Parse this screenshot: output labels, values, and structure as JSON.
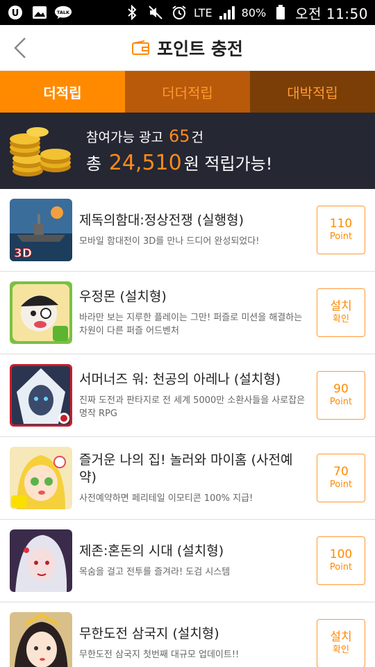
{
  "status_bar": {
    "talk_label": "TALK",
    "network": "LTE",
    "battery": "80%",
    "time": "오전 11:50"
  },
  "header": {
    "title": "포인트 충전",
    "back_icon": "chevron-left-icon",
    "title_icon": "wallet-icon"
  },
  "tabs": [
    {
      "label": "더적립",
      "active": true
    },
    {
      "label": "더더적립",
      "active": false
    },
    {
      "label": "대박적립",
      "active": false
    }
  ],
  "banner": {
    "line1_prefix": "참여가능 광고",
    "ad_count": "65",
    "line1_suffix": "건",
    "line2_prefix": "총",
    "total_points": "24,510",
    "line2_suffix": "원 적립가능!"
  },
  "items": [
    {
      "title": "제독의함대:정상전쟁 (실행형)",
      "desc": "모바일 함대전이 3D를 만나 드디어 완성되었다!",
      "point_top": "110",
      "point_bottom": "Point",
      "thumb_label": "3D"
    },
    {
      "title": "우정몬 (설치형)",
      "desc": "바라만 보는 지루한 플레이는 그만! 퍼즐로 미션을 해결하는 차원이 다른 퍼즐 어드벤처",
      "point_top": "설치",
      "point_bottom": "확인"
    },
    {
      "title": "서머너즈 워: 천공의 아레나 (설치형)",
      "desc": "진짜 도전과 판타지로 전 세계 5000만 소환사들을 사로잡은 명작 RPG",
      "point_top": "90",
      "point_bottom": "Point"
    },
    {
      "title": "즐거운 나의 집! 놀러와 마이홈 (사전예약)",
      "desc": "사전예약하면 페리테일 이모티콘 100% 지급!",
      "point_top": "70",
      "point_bottom": "Point"
    },
    {
      "title": "제존:혼돈의 시대 (설치형)",
      "desc": "목숨을 걸고 전투를 즐겨라! 도검 시스템",
      "point_top": "100",
      "point_bottom": "Point"
    },
    {
      "title": "무한도전 삼국지 (설치형)",
      "desc": "무한도전 삼국지 첫번째 대규모 업데이트!!",
      "point_top": "설치",
      "point_bottom": "확인"
    }
  ],
  "colors": {
    "accent": "#ff8a00",
    "banner_bg": "#252733",
    "tab2_bg": "#b85a0a",
    "tab3_bg": "#7a3e06"
  }
}
